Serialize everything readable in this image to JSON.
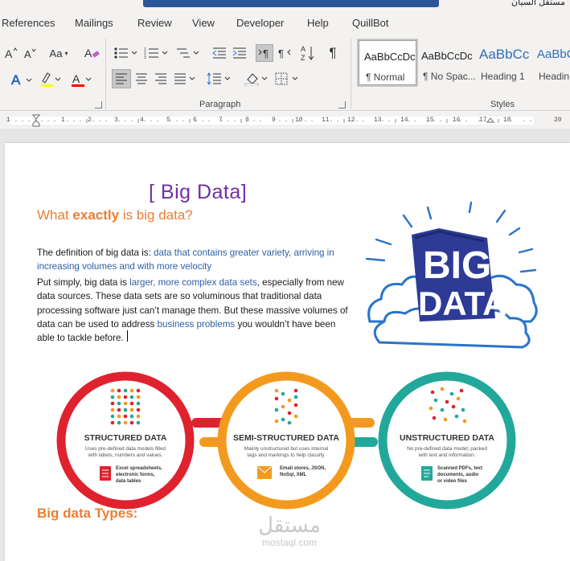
{
  "window": {
    "title_text": "ﻣﺴﺘﻘﻞ ﺍﻟﺴﻴﺎﻥ"
  },
  "menu": {
    "items": [
      "References",
      "Mailings",
      "Review",
      "View",
      "Developer",
      "Help",
      "QuillBot"
    ]
  },
  "ribbon": {
    "paragraph_group_label": "Paragraph",
    "styles_group_label": "Styles",
    "font_case_label": "Aa",
    "styles": [
      {
        "sample": "AaBbCcDc",
        "name": "¶ Normal",
        "selected": true
      },
      {
        "sample": "AaBbCcDc",
        "name": "¶ No Spac...",
        "selected": false
      },
      {
        "sample": "AaBbCc",
        "name": "Heading 1",
        "selected": false
      },
      {
        "sample": "AaBbCc",
        "name": "Headin",
        "selected": false
      }
    ],
    "highlight_color": "#ffff00",
    "font_color": "#ff0000"
  },
  "ruler": {
    "ticks": [
      "1",
      "1",
      "2",
      "3",
      "4",
      "5",
      "6",
      "7",
      "8",
      "9",
      "10",
      "11",
      "12",
      "13",
      "14",
      "15",
      "16",
      "17",
      "18",
      "20"
    ]
  },
  "document": {
    "title": "[ Big Data]",
    "heading1_part1": "What ",
    "heading1_bold": "exactly",
    "heading1_part2": " is big data?",
    "para1_text": "The definition of big data is: ",
    "para1_link": "data that contains greater variety, arriving in increasing volumes and with more velocity",
    "para2_a": "Put simply, big data is ",
    "para2_link1": "larger, more complex data sets",
    "para2_b": ", especially from new data sources. These data sets are so voluminous that traditional data processing software just can’t manage them. But these massive volumes of data can be used to address ",
    "para2_link2": "business problems",
    "para2_c": " you wouldn’t have been able to tackle before.",
    "heading2": "Big data Types:",
    "art_line1": "BIG",
    "art_line2": "DATA",
    "info": [
      {
        "title": "STRUCTURED DATA",
        "desc1": "Uses pre-defined data models filled",
        "desc2": "with labels, numbers and values.",
        "ex1": "Excel spreadsheets,",
        "ex2": "electronic forms,",
        "ex3": "data tables",
        "color": "#e0212e"
      },
      {
        "title": "SEMI-STRUCTURED DATA",
        "desc1": "Mainly unstructured but uses internal",
        "desc2": "tags and markings to help classify.",
        "ex1": "Email stores, JSON,",
        "ex2": "NoSql, XML",
        "ex3": "",
        "color": "#f39a1e"
      },
      {
        "title": "UNSTRUCTURED DATA",
        "desc1": "No pre-defined data model; packed",
        "desc2": "with text and information.",
        "ex1": "Scanned PDFs, text",
        "ex2": "documents, audio",
        "ex3": "or video files",
        "color": "#22a89a"
      }
    ],
    "watermark_ar": "مستقل",
    "watermark_en": "mostaql.com"
  }
}
